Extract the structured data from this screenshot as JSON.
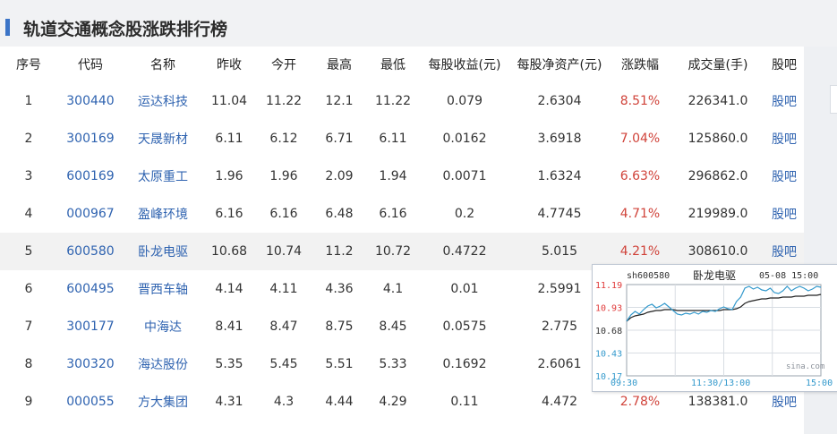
{
  "page": {
    "title": "轨道交通概念股涨跌排行榜"
  },
  "table": {
    "headers": [
      "序号",
      "代码",
      "名称",
      "昨收",
      "今开",
      "最高",
      "最低",
      "每股收益(元)",
      "每股净资产(元)",
      "涨跌幅",
      "成交量(手)",
      "股吧"
    ],
    "rows": [
      {
        "idx": "1",
        "code": "300440",
        "name": "运达科技",
        "prev": "11.04",
        "open": "11.22",
        "high": "12.1",
        "low": "11.22",
        "eps": "0.079",
        "bvps": "2.6304",
        "chg": "8.51%",
        "vol": "226341.0",
        "bar": "股吧"
      },
      {
        "idx": "2",
        "code": "300169",
        "name": "天晟新材",
        "prev": "6.11",
        "open": "6.12",
        "high": "6.71",
        "low": "6.11",
        "eps": "0.0162",
        "bvps": "3.6918",
        "chg": "7.04%",
        "vol": "125860.0",
        "bar": "股吧"
      },
      {
        "idx": "3",
        "code": "600169",
        "name": "太原重工",
        "prev": "1.96",
        "open": "1.96",
        "high": "2.09",
        "low": "1.94",
        "eps": "0.0071",
        "bvps": "1.6324",
        "chg": "6.63%",
        "vol": "296862.0",
        "bar": "股吧"
      },
      {
        "idx": "4",
        "code": "000967",
        "name": "盈峰环境",
        "prev": "6.16",
        "open": "6.16",
        "high": "6.48",
        "low": "6.16",
        "eps": "0.2",
        "bvps": "4.7745",
        "chg": "4.71%",
        "vol": "219989.0",
        "bar": "股吧"
      },
      {
        "idx": "5",
        "code": "600580",
        "name": "卧龙电驱",
        "prev": "10.68",
        "open": "10.74",
        "high": "11.2",
        "low": "10.72",
        "eps": "0.4722",
        "bvps": "5.015",
        "chg": "4.21%",
        "vol": "308610.0",
        "bar": "股吧"
      },
      {
        "idx": "6",
        "code": "600495",
        "name": "晋西车轴",
        "prev": "4.14",
        "open": "4.11",
        "high": "4.36",
        "low": "4.1",
        "eps": "0.01",
        "bvps": "2.5991",
        "chg": "",
        "vol": "",
        "bar": ""
      },
      {
        "idx": "7",
        "code": "300177",
        "name": "中海达",
        "prev": "8.41",
        "open": "8.47",
        "high": "8.75",
        "low": "8.45",
        "eps": "0.0575",
        "bvps": "2.775",
        "chg": "",
        "vol": "",
        "bar": ""
      },
      {
        "idx": "8",
        "code": "300320",
        "name": "海达股份",
        "prev": "5.35",
        "open": "5.45",
        "high": "5.51",
        "low": "5.33",
        "eps": "0.1692",
        "bvps": "2.6061",
        "chg": "",
        "vol": "",
        "bar": ""
      },
      {
        "idx": "9",
        "code": "000055",
        "name": "方大集团",
        "prev": "4.31",
        "open": "4.3",
        "high": "4.44",
        "low": "4.29",
        "eps": "0.11",
        "bvps": "4.472",
        "chg": "2.78%",
        "vol": "138381.0",
        "bar": "股吧"
      }
    ]
  },
  "popup": {
    "symbol": "sh600580",
    "name": "卧龙电驱",
    "datetime": "05-08 15:00",
    "source": "sina.com",
    "yticks": [
      "11.19",
      "10.93",
      "10.68",
      "10.43",
      "10.17"
    ],
    "xticks": [
      "09:30",
      "11:30/13:00",
      "15:00"
    ],
    "price_color": "#3399cc",
    "avg_color": "#222222",
    "axis_color": "#e03a3a",
    "price_series": [
      10.78,
      10.85,
      10.89,
      10.86,
      10.91,
      10.95,
      10.97,
      10.93,
      10.95,
      10.98,
      10.94,
      10.9,
      10.86,
      10.85,
      10.87,
      10.86,
      10.88,
      10.86,
      10.89,
      10.88,
      10.9,
      10.89,
      10.92,
      10.94,
      10.92,
      10.91,
      11.0,
      11.05,
      11.15,
      11.17,
      11.14,
      11.16,
      11.13,
      11.12,
      11.15,
      11.1,
      11.09,
      11.12,
      11.17,
      11.12,
      11.15,
      11.17,
      11.15,
      11.12,
      11.14,
      11.17,
      11.16
    ],
    "avg_series": [
      10.78,
      10.82,
      10.84,
      10.85,
      10.86,
      10.88,
      10.89,
      10.9,
      10.9,
      10.91,
      10.91,
      10.91,
      10.9,
      10.9,
      10.9,
      10.9,
      10.9,
      10.9,
      10.9,
      10.9,
      10.9,
      10.9,
      10.9,
      10.91,
      10.91,
      10.91,
      10.92,
      10.94,
      10.98,
      11.0,
      11.01,
      11.02,
      11.03,
      11.03,
      11.04,
      11.04,
      11.04,
      11.05,
      11.05,
      11.05,
      11.06,
      11.06,
      11.06,
      11.07,
      11.07,
      11.07,
      11.08
    ]
  }
}
